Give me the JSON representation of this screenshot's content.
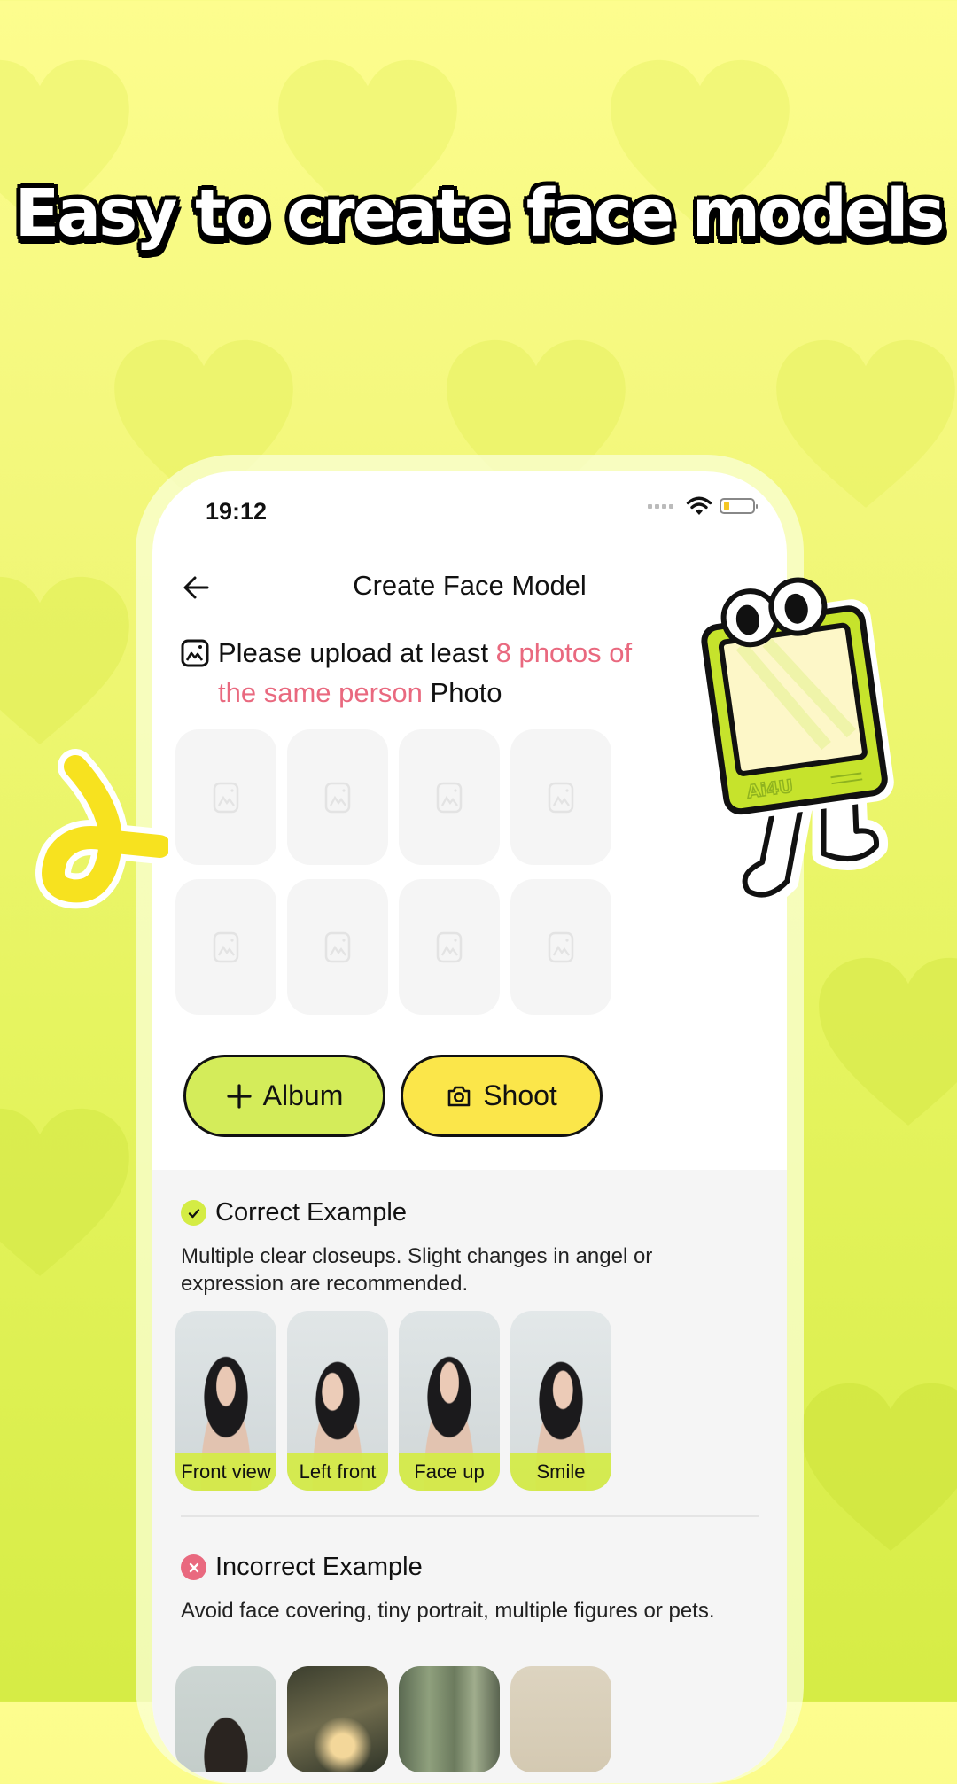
{
  "headline": "Easy to create face models",
  "status_bar": {
    "time": "19:12",
    "battery_percent": 20
  },
  "nav": {
    "title": "Create Face Model",
    "back_icon": "arrow-left-icon"
  },
  "notice": {
    "prefix": "Please upload at least ",
    "highlight_1": "8 photos of",
    "highlight_2": "the same person",
    "suffix": " Photo",
    "icon": "image-icon",
    "highlight_color": "#e9697f"
  },
  "upload_slots": {
    "count": 8,
    "icon": "image-placeholder-icon"
  },
  "buttons": {
    "album": {
      "label": "Album",
      "icon": "plus-icon",
      "color": "#d4ec5a"
    },
    "shoot": {
      "label": "Shoot",
      "icon": "camera-icon",
      "color": "#fbe64a"
    }
  },
  "correct": {
    "title": "Correct Example",
    "icon": "check-circle-icon",
    "description": "Multiple clear closeups. Slight changes in angel or expression are recommended.",
    "examples": [
      {
        "label": "Front view"
      },
      {
        "label": "Left front"
      },
      {
        "label": "Face up"
      },
      {
        "label": "Smile"
      }
    ]
  },
  "incorrect": {
    "title": "Incorrect Example",
    "icon": "x-circle-icon",
    "description": "Avoid face covering, tiny portrait, multiple figures or pets.",
    "examples_count": 4
  },
  "mascot": {
    "brand_text": "Ai4U"
  },
  "colors": {
    "accent_green": "#d4ec44",
    "accent_yellow": "#fbe64a",
    "error_pink": "#e9697f"
  }
}
